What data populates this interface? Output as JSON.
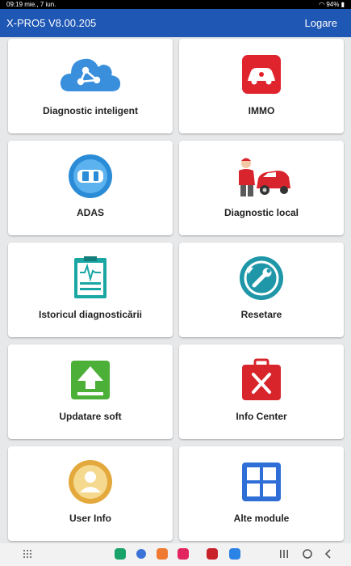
{
  "status": {
    "time": "09:19",
    "date": "mie., 7 iun.",
    "battery": "94%"
  },
  "header": {
    "title": "X-PRO5 V8.00.205",
    "login_label": "Logare"
  },
  "tiles": [
    {
      "label": "Diagnostic inteligent",
      "icon": "cloud-share-icon"
    },
    {
      "label": "IMMO",
      "icon": "car-key-icon"
    },
    {
      "label": "ADAS",
      "icon": "car-radar-icon"
    },
    {
      "label": "Diagnostic local",
      "icon": "mechanic-car-icon"
    },
    {
      "label": "Istoricul diagnosticării",
      "icon": "clipboard-waveform-icon"
    },
    {
      "label": "Resetare",
      "icon": "reset-wrench-icon"
    },
    {
      "label": "Updatare soft",
      "icon": "upload-arrow-icon"
    },
    {
      "label": "Info Center",
      "icon": "toolbox-icon"
    },
    {
      "label": "User Info",
      "icon": "user-icon"
    },
    {
      "label": "Alte module",
      "icon": "modules-grid-icon"
    }
  ],
  "colors": {
    "appbar": "#1f57b5",
    "background": "#e7e8ea",
    "card": "#ffffff"
  }
}
